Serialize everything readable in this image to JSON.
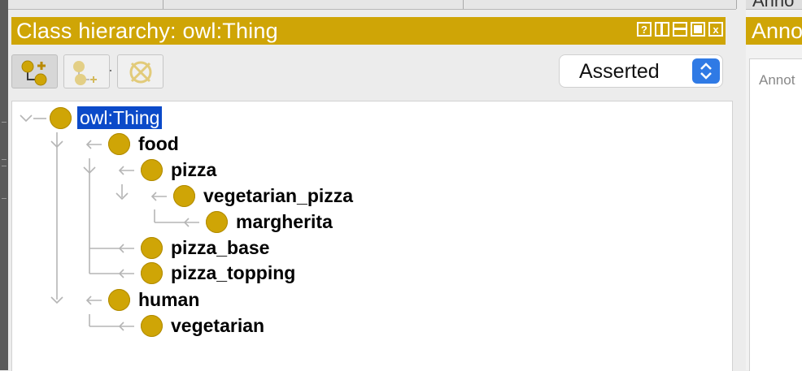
{
  "panel": {
    "title": "Class hierarchy: owl:Thing",
    "window_buttons": [
      "?",
      "",
      "",
      "",
      "x"
    ]
  },
  "toolbar": {
    "add_subclass_icon": "add-subclass-icon",
    "add_sibling_icon": "add-sibling-icon",
    "delete_icon": "delete-class-icon"
  },
  "view_selector": {
    "value": "Asserted"
  },
  "tree": {
    "root": "owl:Thing",
    "food": "food",
    "pizza": "pizza",
    "vegetarian_pizza": "vegetarian_pizza",
    "margherita": "margherita",
    "pizza_base": "pizza_base",
    "pizza_topping": "pizza_topping",
    "human": "human",
    "vegetarian": "vegetarian"
  },
  "right_panel": {
    "header": "Anno",
    "tab": "Anno",
    "content_label": "Annot"
  },
  "colors": {
    "header": "#cfa506",
    "class_dot": "#cfa506",
    "selection": "#0b4ac9",
    "selector_accent": "#2f7ae5"
  }
}
